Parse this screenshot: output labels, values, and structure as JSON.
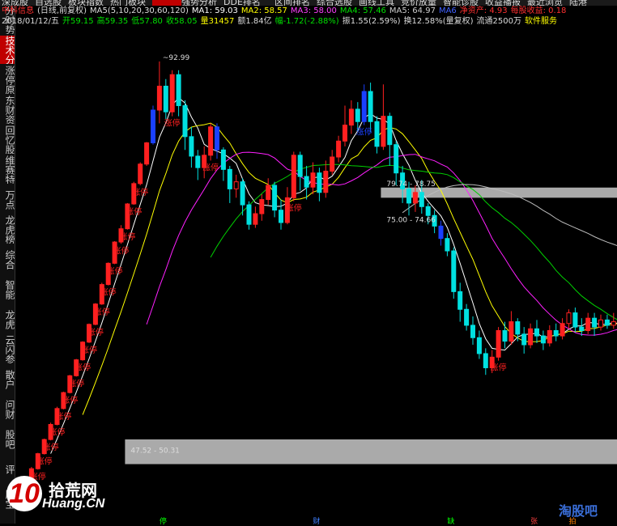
{
  "menu_tabs": [
    "深成股",
    "自选股",
    "板块指数",
    "热门板块",
    "",
    "强势分析",
    "DDE排名",
    "区间排名",
    "综合选股",
    "画线工具",
    "竞价放量",
    "智能诊股",
    "收益播报",
    "最近浏览",
    "陆港"
  ],
  "sidebar_tabs": [
    "分时势",
    "技术分析",
    "涨停原因",
    "东财资料",
    "回忆股",
    "维赛特",
    "万点",
    "龙虎榜",
    "综合",
    "智能",
    "龙虎",
    "云闪参",
    "散户",
    "问财",
    "股吧",
    "评",
    "股宝"
  ],
  "active_sidebar_index": 1,
  "header": {
    "stock": "中科信息",
    "mode": "(日线,前复权)",
    "ma_label": "MA5(5,10,20,30,60,120)",
    "ma1": "MA1: 59.03",
    "ma2": "MA2: 58.57",
    "ma3": "MA3: 58.00",
    "ma4": "MA4: 57.46",
    "ma5": "MA5: 64.97",
    "ma6": "MA6",
    "net_asset": "净资产: 4.93",
    "eps": "每股收益: 0.18"
  },
  "quote": {
    "date": "2018/01/12/五",
    "open": "开59.15",
    "high": "高59.35",
    "low": "低57.80",
    "close": "收58.05",
    "volume": "量31457",
    "amount": "额1.84亿",
    "change": "幅-1.72(-2.88%)",
    "amplitude": "振1.55(2.59%)",
    "turnover": "换12.58%(量复权)",
    "float": "流通2500万",
    "service": "软件服务"
  },
  "colors": {
    "up": "#ff2020",
    "down": "#00e0e0",
    "blue": "#1a40ff",
    "ma_white": "#ffffff",
    "ma_yellow": "#ffff00",
    "ma_magenta": "#ff20ff",
    "ma_green": "#00d000",
    "ma_gray": "#bbbbbb",
    "zone": "#c8c8c8"
  },
  "logo": {
    "mark": "10",
    "cn": "拾荒网",
    "en": "Huang.CN"
  },
  "watermark": "淘股吧",
  "chart_data": {
    "type": "candlestick",
    "ylim": [
      43,
      96
    ],
    "candles": [
      {
        "o": 44.0,
        "c": 45.5,
        "h": 45.7,
        "l": 43.8
      },
      {
        "o": 45.5,
        "c": 47.0,
        "h": 47.2,
        "l": 45.4
      },
      {
        "o": 47.0,
        "c": 48.7,
        "h": 48.8,
        "l": 46.9
      },
      {
        "o": 48.7,
        "c": 50.3,
        "h": 50.4,
        "l": 48.6
      },
      {
        "o": 50.3,
        "c": 52.0,
        "h": 52.2,
        "l": 50.2
      },
      {
        "o": 52.0,
        "c": 53.8,
        "h": 54.0,
        "l": 51.9
      },
      {
        "o": 53.8,
        "c": 55.6,
        "h": 55.7,
        "l": 53.7
      },
      {
        "o": 55.6,
        "c": 57.5,
        "h": 57.6,
        "l": 55.5
      },
      {
        "o": 57.5,
        "c": 59.3,
        "h": 59.4,
        "l": 57.4
      },
      {
        "o": 59.3,
        "c": 61.3,
        "h": 61.4,
        "l": 59.2
      },
      {
        "o": 61.3,
        "c": 63.3,
        "h": 63.4,
        "l": 61.2
      },
      {
        "o": 63.3,
        "c": 65.6,
        "h": 65.7,
        "l": 63.2
      },
      {
        "o": 65.6,
        "c": 67.8,
        "h": 68.0,
        "l": 65.5
      },
      {
        "o": 67.8,
        "c": 70.2,
        "h": 70.3,
        "l": 67.7
      },
      {
        "o": 70.2,
        "c": 72.6,
        "h": 72.7,
        "l": 70.1
      },
      {
        "o": 72.6,
        "c": 74.1,
        "h": 74.5,
        "l": 72.4
      },
      {
        "o": 74.1,
        "c": 76.9,
        "h": 77.0,
        "l": 74.0
      },
      {
        "o": 76.9,
        "c": 79.2,
        "h": 79.4,
        "l": 76.8
      },
      {
        "o": 79.2,
        "c": 81.4,
        "h": 81.6,
        "l": 79.0
      },
      {
        "o": 81.4,
        "c": 83.8,
        "h": 83.9,
        "l": 81.2
      },
      {
        "o": 83.8,
        "c": 87.5,
        "h": 88.0,
        "l": 83.6
      },
      {
        "o": 87.5,
        "c": 90.2,
        "h": 92.99,
        "l": 86.0
      },
      {
        "o": 90.2,
        "c": 87.3,
        "h": 91.0,
        "l": 86.5
      },
      {
        "o": 87.3,
        "c": 91.5,
        "h": 92.0,
        "l": 86.8
      },
      {
        "o": 91.5,
        "c": 88.0,
        "h": 92.0,
        "l": 86.8
      },
      {
        "o": 88.0,
        "c": 84.5,
        "h": 88.6,
        "l": 83.0
      },
      {
        "o": 84.5,
        "c": 82.3,
        "h": 85.6,
        "l": 81.0
      },
      {
        "o": 82.3,
        "c": 81.0,
        "h": 83.0,
        "l": 79.6
      },
      {
        "o": 81.0,
        "c": 82.4,
        "h": 83.4,
        "l": 79.8
      },
      {
        "o": 82.4,
        "c": 85.6,
        "h": 86.0,
        "l": 81.8
      },
      {
        "o": 85.6,
        "c": 83.0,
        "h": 86.0,
        "l": 82.0
      },
      {
        "o": 83.0,
        "c": 80.8,
        "h": 83.3,
        "l": 79.5
      },
      {
        "o": 80.8,
        "c": 78.6,
        "h": 81.2,
        "l": 77.0
      },
      {
        "o": 78.6,
        "c": 79.4,
        "h": 80.2,
        "l": 77.6
      },
      {
        "o": 79.4,
        "c": 76.8,
        "h": 79.8,
        "l": 75.6
      },
      {
        "o": 76.8,
        "c": 74.6,
        "h": 77.2,
        "l": 74.0
      },
      {
        "o": 74.6,
        "c": 75.8,
        "h": 76.6,
        "l": 74.2
      },
      {
        "o": 75.8,
        "c": 77.4,
        "h": 78.0,
        "l": 75.0
      },
      {
        "o": 77.4,
        "c": 79.0,
        "h": 79.8,
        "l": 76.8
      },
      {
        "o": 79.0,
        "c": 76.2,
        "h": 79.4,
        "l": 75.4
      },
      {
        "o": 76.2,
        "c": 74.8,
        "h": 77.4,
        "l": 74.0
      },
      {
        "o": 74.8,
        "c": 77.6,
        "h": 78.8,
        "l": 74.6
      },
      {
        "o": 77.6,
        "c": 82.4,
        "h": 82.8,
        "l": 77.2
      },
      {
        "o": 82.4,
        "c": 80.0,
        "h": 82.8,
        "l": 78.4
      },
      {
        "o": 80.0,
        "c": 78.8,
        "h": 81.2,
        "l": 77.4
      },
      {
        "o": 78.8,
        "c": 80.4,
        "h": 81.6,
        "l": 78.0
      },
      {
        "o": 80.4,
        "c": 78.2,
        "h": 81.0,
        "l": 77.2
      },
      {
        "o": 78.2,
        "c": 80.6,
        "h": 81.8,
        "l": 77.6
      },
      {
        "o": 80.6,
        "c": 82.2,
        "h": 83.0,
        "l": 80.2
      },
      {
        "o": 82.2,
        "c": 84.0,
        "h": 84.6,
        "l": 81.6
      },
      {
        "o": 84.0,
        "c": 85.8,
        "h": 88.0,
        "l": 83.4
      },
      {
        "o": 85.8,
        "c": 87.6,
        "h": 88.6,
        "l": 84.8
      },
      {
        "o": 87.6,
        "c": 86.2,
        "h": 88.4,
        "l": 85.2
      },
      {
        "o": 86.2,
        "c": 89.6,
        "h": 90.4,
        "l": 85.8
      },
      {
        "o": 89.6,
        "c": 86.2,
        "h": 90.6,
        "l": 85.0
      },
      {
        "o": 86.2,
        "c": 83.4,
        "h": 86.8,
        "l": 82.6
      },
      {
        "o": 83.4,
        "c": 86.8,
        "h": 90.4,
        "l": 83.0
      },
      {
        "o": 86.8,
        "c": 83.6,
        "h": 87.2,
        "l": 81.2
      },
      {
        "o": 83.6,
        "c": 80.4,
        "h": 84.0,
        "l": 79.0
      },
      {
        "o": 80.4,
        "c": 78.6,
        "h": 81.2,
        "l": 77.0
      },
      {
        "o": 78.6,
        "c": 77.0,
        "h": 79.4,
        "l": 75.6
      },
      {
        "o": 77.0,
        "c": 78.2,
        "h": 79.0,
        "l": 76.0
      },
      {
        "o": 78.2,
        "c": 76.6,
        "h": 79.6,
        "l": 75.8
      },
      {
        "o": 76.6,
        "c": 75.6,
        "h": 77.0,
        "l": 74.6
      },
      {
        "o": 75.6,
        "c": 74.4,
        "h": 76.2,
        "l": 73.6
      },
      {
        "o": 74.4,
        "c": 73.0,
        "h": 75.0,
        "l": 72.2
      },
      {
        "o": 73.0,
        "c": 71.6,
        "h": 73.6,
        "l": 71.0
      },
      {
        "o": 71.6,
        "c": 67.0,
        "h": 72.0,
        "l": 66.2
      },
      {
        "o": 67.0,
        "c": 65.0,
        "h": 68.0,
        "l": 63.6
      },
      {
        "o": 65.0,
        "c": 63.2,
        "h": 65.6,
        "l": 62.6
      },
      {
        "o": 63.2,
        "c": 61.8,
        "h": 64.2,
        "l": 61.0
      },
      {
        "o": 61.8,
        "c": 60.0,
        "h": 62.6,
        "l": 59.4
      },
      {
        "o": 60.0,
        "c": 58.4,
        "h": 60.6,
        "l": 57.6
      },
      {
        "o": 58.4,
        "c": 59.6,
        "h": 60.4,
        "l": 57.8
      },
      {
        "o": 59.6,
        "c": 62.6,
        "h": 63.0,
        "l": 59.2
      },
      {
        "o": 62.6,
        "c": 61.4,
        "h": 63.6,
        "l": 60.6
      },
      {
        "o": 61.4,
        "c": 63.6,
        "h": 64.8,
        "l": 61.0
      },
      {
        "o": 63.6,
        "c": 62.2,
        "h": 64.0,
        "l": 61.4
      },
      {
        "o": 62.2,
        "c": 61.0,
        "h": 63.0,
        "l": 60.0
      },
      {
        "o": 61.0,
        "c": 62.8,
        "h": 63.4,
        "l": 60.6
      },
      {
        "o": 62.8,
        "c": 62.0,
        "h": 63.8,
        "l": 61.2
      },
      {
        "o": 62.0,
        "c": 61.2,
        "h": 62.6,
        "l": 60.4
      },
      {
        "o": 61.2,
        "c": 62.6,
        "h": 63.2,
        "l": 60.8
      },
      {
        "o": 62.6,
        "c": 62.0,
        "h": 63.4,
        "l": 61.4
      },
      {
        "o": 62.0,
        "c": 63.4,
        "h": 64.0,
        "l": 61.6
      },
      {
        "o": 63.4,
        "c": 64.6,
        "h": 65.0,
        "l": 62.8
      },
      {
        "o": 64.6,
        "c": 63.0,
        "h": 65.2,
        "l": 62.4
      },
      {
        "o": 63.0,
        "c": 62.6,
        "h": 64.0,
        "l": 62.0
      },
      {
        "o": 62.6,
        "c": 64.0,
        "h": 64.6,
        "l": 62.2
      },
      {
        "o": 64.0,
        "c": 63.0,
        "h": 64.6,
        "l": 62.0
      },
      {
        "o": 63.0,
        "c": 63.8,
        "h": 64.4,
        "l": 62.6
      },
      {
        "o": 63.8,
        "c": 63.2,
        "h": 64.4,
        "l": 62.8
      },
      {
        "o": 63.2,
        "c": 63.6,
        "h": 64.6,
        "l": 62.8
      },
      {
        "o": 63.6,
        "c": 63.1,
        "h": 64.2,
        "l": 62.6
      }
    ],
    "blue_candles": [
      20,
      30,
      53,
      65
    ],
    "limit_up_labels": [
      {
        "i": 0,
        "text": "涨停"
      },
      {
        "i": 1,
        "text": "涨停"
      },
      {
        "i": 2,
        "text": "涨停"
      },
      {
        "i": 3,
        "text": "涨停"
      },
      {
        "i": 4,
        "text": "涨停"
      },
      {
        "i": 5,
        "text": "涨停"
      },
      {
        "i": 6,
        "text": "涨停"
      },
      {
        "i": 7,
        "text": "涨停"
      },
      {
        "i": 8,
        "text": "涨停"
      },
      {
        "i": 9,
        "text": "涨停"
      },
      {
        "i": 10,
        "text": "涨停"
      },
      {
        "i": 11,
        "text": "涨停"
      },
      {
        "i": 12,
        "text": "涨停"
      },
      {
        "i": 13,
        "text": "涨停"
      },
      {
        "i": 14,
        "text": "涨停"
      },
      {
        "i": 15,
        "text": "涨停"
      },
      {
        "i": 16,
        "text": "涨停"
      },
      {
        "i": 17,
        "text": "涨停"
      },
      {
        "i": 18,
        "text": "涨停"
      },
      {
        "i": 23,
        "text": "涨停"
      },
      {
        "i": 29,
        "text": "涨停"
      },
      {
        "i": 42,
        "text": "涨停"
      },
      {
        "i": 53,
        "text": "涨停"
      },
      {
        "i": 74,
        "text": "涨停"
      }
    ],
    "annotations": [
      {
        "text": "~92.99",
        "i": 21,
        "y": 92.99
      },
      {
        "text": "47.52 - 50.31",
        "i": 16,
        "y": 48.6
      },
      {
        "text": "79.74 - 78.75",
        "i": 56,
        "y": 78.75
      },
      {
        "text": "75.00 - 74.66",
        "i": 56,
        "y": 74.66
      }
    ],
    "zones": [
      {
        "y1": 50.31,
        "y2": 47.52,
        "from_i": 16
      },
      {
        "y1": 78.75,
        "y2": 77.6,
        "from_i": 56
      }
    ],
    "bottom_marks": [
      {
        "i": 21,
        "text": "停",
        "color": "#00ff00"
      },
      {
        "i": 45,
        "text": "财",
        "color": "#4080ff"
      },
      {
        "i": 66,
        "text": "缺",
        "color": "#00ff00"
      },
      {
        "i": 79,
        "text": "张",
        "color": "#ff4040"
      },
      {
        "i": 85,
        "text": "拍",
        "color": "#ff8000"
      }
    ]
  }
}
